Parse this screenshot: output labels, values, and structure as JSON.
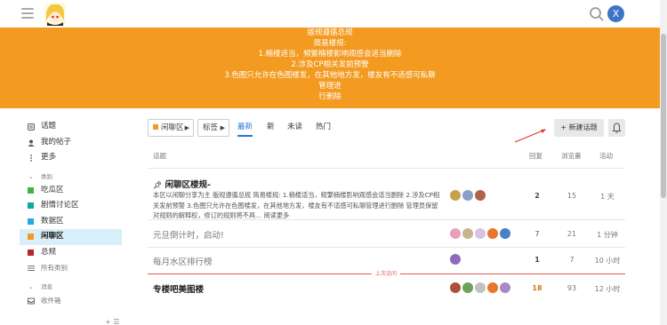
{
  "header": {
    "user_initial": "X"
  },
  "banner": {
    "lines": [
      "版规遵循总规",
      "简易楼规:",
      "1.楠楼适当，频繁楠楼影响观感会适当删除",
      "2.涉及CP相关发前预警",
      "3.色图只允许在色图楼发，在其他地方发，楼友有不适感可私聊管理进",
      "行删除"
    ]
  },
  "sidebar": {
    "items": [
      {
        "label": "话题"
      },
      {
        "label": "我的帖子"
      },
      {
        "label": "更多"
      }
    ],
    "categories_heading": "类别",
    "categories": [
      {
        "label": "吃瓜区",
        "color": "#3fb149"
      },
      {
        "label": "剧情讨论区",
        "color": "#12a89d"
      },
      {
        "label": "数据区",
        "color": "#25aae2"
      },
      {
        "label": "闲聊区",
        "color": "#f39a21"
      },
      {
        "label": "总规",
        "color": "#b3262b"
      }
    ],
    "all_categories": "所有类别",
    "messages_heading": "消息",
    "inbox": "收件箱"
  },
  "controls": {
    "category_dropdown": "闲聊区",
    "tags_dropdown": "标签",
    "tabs": [
      "最新",
      "新",
      "未读",
      "热门"
    ],
    "new_topic": "+ 新建话题"
  },
  "table": {
    "headers": {
      "topic": "话题",
      "replies": "回复",
      "views": "浏览量",
      "activity": "活动"
    },
    "rows": [
      {
        "title": "闲聊区楼规-",
        "excerpt": "本区以闲聊分享为主 版规遵循总规 简易楼规: 1.楠楼适当，频繁楠楼影响观感会适当删除 2.涉及CP相关发前预警 3.色图只允许在色图楼发，在其他地方发，楼友有不适感可私聊管理进行删除 管理员保留对规则的解释权，修订的规则将不具… 阅读更多",
        "replies": "2",
        "views": "15",
        "activity": "1 天"
      },
      {
        "title": "元旦倒计时，启动!",
        "replies": "7",
        "views": "21",
        "activity": "1 分钟"
      },
      {
        "title": "每月水区排行榜",
        "replies": "1",
        "views": "7",
        "activity": "10 小时"
      },
      {
        "title": "专楼吧美图楼",
        "replies": "18",
        "views": "93",
        "activity": "12 小时"
      }
    ],
    "last_visit": "上次访问"
  },
  "colors": {
    "banner": "#f39a21",
    "accent": "#2679d3",
    "last_visit": "#e45757"
  }
}
